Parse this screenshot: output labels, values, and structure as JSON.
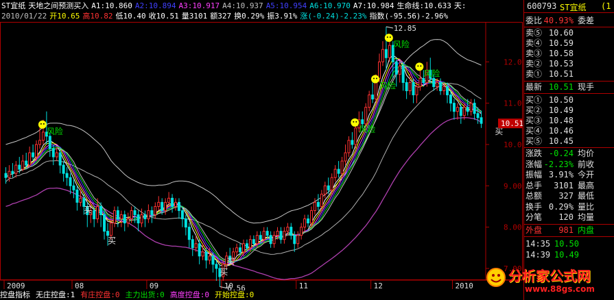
{
  "header": {
    "row1": [
      {
        "text": "ST宜纸",
        "color": "#ffffff"
      },
      {
        "text": "天地之间预测买入",
        "color": "#ffffff"
      },
      {
        "text": "A1:10.860",
        "color": "#ffffff"
      },
      {
        "text": "A2:10.894",
        "color": "#4040ff"
      },
      {
        "text": "A3:10.917",
        "color": "#ff40ff"
      },
      {
        "text": "A4:10.937",
        "color": "#c0c0c0"
      },
      {
        "text": "A5:10.954",
        "color": "#4040ff"
      },
      {
        "text": "A6:10.970",
        "color": "#00e0e0"
      },
      {
        "text": "A7:10.984",
        "color": "#ffffff"
      },
      {
        "text": "生命线:10.633",
        "color": "#ffffff"
      },
      {
        "text": "天:",
        "color": "#ffffff"
      }
    ],
    "row2": [
      {
        "text": "2010/01/22",
        "color": "#c0c0c0"
      },
      {
        "text": "开10.65",
        "color": "#ffff00"
      },
      {
        "text": "高10.82",
        "color": "#ff3232"
      },
      {
        "text": "低10.40",
        "color": "#ffffff"
      },
      {
        "text": "收10.51",
        "color": "#ffffff"
      },
      {
        "text": "量3101",
        "color": "#ffffff"
      },
      {
        "text": "额327",
        "color": "#ffffff"
      },
      {
        "text": "换0.29%",
        "color": "#ffffff"
      },
      {
        "text": "振3.91%",
        "color": "#ffffff"
      },
      {
        "text": "涨(-0.24)-2.23%",
        "color": "#00e0e0"
      },
      {
        "text": "指数(-95.56)-2.96%",
        "color": "#ffffff"
      }
    ]
  },
  "chart_data": {
    "type": "candlestick",
    "y_ticks": [
      "12.00",
      "11.00",
      "10.00",
      "9.00",
      "8.00",
      "7.00"
    ],
    "y_values": [
      12.0,
      11.0,
      10.0,
      9.0,
      8.0,
      7.0
    ],
    "ylim": [
      6.75,
      12.95
    ],
    "x_labels": [
      "2009",
      "08",
      "09",
      "10",
      "11",
      "12",
      "2010"
    ],
    "x_label_index": [
      0,
      20,
      42,
      64,
      86,
      108,
      132
    ],
    "current_price_label": "10.51",
    "high_label": "12.85",
    "low_label": "6.56",
    "annotations": [
      {
        "text": "风险",
        "index": 12,
        "price": 10.25
      },
      {
        "text": "风险",
        "index": 104,
        "price": 10.3
      },
      {
        "text": "风险",
        "index": 110,
        "price": 11.35
      },
      {
        "text": "风险",
        "index": 114,
        "price": 12.35
      },
      {
        "text": "风险",
        "index": 123,
        "price": 11.65
      },
      {
        "text": "买",
        "index": 23,
        "price": 8.35
      },
      {
        "text": "买",
        "index": 30,
        "price": 7.6
      },
      {
        "text": "买",
        "index": 65,
        "price": 7.1
      },
      {
        "text": "买",
        "index": 63,
        "price": 6.85
      },
      {
        "text": "买",
        "index": 144,
        "price": 10.25
      }
    ],
    "candles": [
      [
        9.3,
        9.2,
        9.45,
        9.05
      ],
      [
        9.2,
        9.35,
        9.5,
        9.1
      ],
      [
        9.35,
        9.3,
        9.55,
        9.2
      ],
      [
        9.3,
        9.5,
        9.6,
        9.2
      ],
      [
        9.5,
        9.4,
        9.7,
        9.3
      ],
      [
        9.4,
        9.6,
        9.75,
        9.35
      ],
      [
        9.6,
        9.5,
        9.8,
        9.4
      ],
      [
        9.5,
        9.8,
        9.95,
        9.45
      ],
      [
        9.8,
        9.7,
        10.0,
        9.6
      ],
      [
        9.7,
        10.0,
        10.1,
        9.6
      ],
      [
        10.0,
        10.1,
        10.4,
        9.9
      ],
      [
        10.1,
        10.3,
        10.6,
        10.0
      ],
      [
        10.3,
        10.2,
        10.8,
        10.0
      ],
      [
        10.2,
        9.9,
        10.3,
        9.7
      ],
      [
        9.9,
        9.7,
        10.0,
        9.5
      ],
      [
        9.7,
        9.8,
        9.95,
        9.6
      ],
      [
        9.8,
        9.5,
        9.9,
        9.3
      ],
      [
        9.5,
        9.3,
        9.6,
        9.1
      ],
      [
        9.3,
        9.2,
        9.45,
        9.0
      ],
      [
        9.2,
        9.0,
        9.3,
        8.8
      ],
      [
        9.0,
        8.9,
        9.15,
        8.7
      ],
      [
        8.9,
        8.6,
        9.0,
        8.4
      ],
      [
        8.6,
        8.7,
        8.9,
        8.5
      ],
      [
        8.7,
        8.5,
        8.8,
        8.3
      ],
      [
        8.5,
        8.3,
        8.6,
        8.0
      ],
      [
        8.3,
        8.4,
        8.6,
        8.1
      ],
      [
        8.4,
        8.2,
        8.5,
        8.0
      ],
      [
        8.2,
        8.5,
        8.7,
        8.1
      ],
      [
        8.5,
        8.3,
        8.6,
        8.0
      ],
      [
        8.3,
        7.9,
        8.4,
        7.7
      ],
      [
        7.9,
        7.8,
        8.1,
        7.55
      ],
      [
        7.8,
        8.1,
        8.3,
        7.7
      ],
      [
        8.1,
        8.4,
        8.5,
        8.0
      ],
      [
        8.4,
        8.2,
        8.5,
        8.0
      ],
      [
        8.2,
        8.3,
        8.4,
        8.0
      ],
      [
        8.3,
        8.1,
        8.4,
        7.9
      ],
      [
        8.1,
        8.2,
        8.35,
        8.0
      ],
      [
        8.2,
        8.4,
        8.5,
        8.1
      ],
      [
        8.4,
        8.3,
        8.5,
        8.1
      ],
      [
        8.3,
        8.1,
        8.4,
        7.9
      ],
      [
        8.1,
        8.3,
        8.45,
        8.0
      ],
      [
        8.3,
        8.2,
        8.4,
        8.0
      ],
      [
        8.2,
        8.4,
        8.55,
        8.1
      ],
      [
        8.4,
        8.3,
        8.5,
        8.1
      ],
      [
        8.3,
        8.5,
        8.6,
        8.2
      ],
      [
        8.5,
        8.6,
        8.75,
        8.4
      ],
      [
        8.6,
        8.4,
        8.7,
        8.3
      ],
      [
        8.4,
        8.6,
        8.7,
        8.3
      ],
      [
        8.6,
        8.7,
        8.85,
        8.5
      ],
      [
        8.7,
        8.5,
        8.8,
        8.35
      ],
      [
        8.5,
        8.6,
        8.7,
        8.4
      ],
      [
        8.6,
        8.4,
        8.7,
        8.2
      ],
      [
        8.4,
        8.2,
        8.5,
        8.0
      ],
      [
        8.2,
        8.0,
        8.3,
        7.8
      ],
      [
        8.0,
        7.7,
        8.1,
        7.5
      ],
      [
        7.7,
        7.5,
        7.8,
        7.3
      ],
      [
        7.5,
        7.6,
        7.8,
        7.4
      ],
      [
        7.6,
        7.3,
        7.7,
        7.1
      ],
      [
        7.3,
        7.4,
        7.6,
        7.2
      ],
      [
        7.4,
        7.2,
        7.5,
        7.0
      ],
      [
        7.2,
        7.3,
        7.5,
        7.1
      ],
      [
        7.3,
        7.1,
        7.4,
        6.9
      ],
      [
        7.1,
        7.0,
        7.2,
        6.7
      ],
      [
        7.0,
        6.8,
        7.1,
        6.56
      ],
      [
        6.8,
        7.1,
        7.2,
        6.7
      ],
      [
        7.1,
        7.3,
        7.4,
        7.0
      ],
      [
        7.3,
        7.2,
        7.5,
        7.1
      ],
      [
        7.2,
        7.4,
        7.5,
        7.1
      ],
      [
        7.4,
        7.5,
        7.6,
        7.3
      ],
      [
        7.5,
        7.4,
        7.6,
        7.3
      ],
      [
        7.4,
        7.6,
        7.7,
        7.3
      ],
      [
        7.6,
        7.5,
        7.7,
        7.4
      ],
      [
        7.5,
        7.7,
        7.8,
        7.4
      ],
      [
        7.7,
        7.6,
        7.8,
        7.5
      ],
      [
        7.6,
        7.8,
        7.9,
        7.5
      ],
      [
        7.8,
        7.7,
        7.9,
        7.6
      ],
      [
        7.7,
        7.9,
        8.0,
        7.6
      ],
      [
        7.9,
        7.8,
        8.0,
        7.7
      ],
      [
        7.8,
        7.6,
        7.9,
        7.5
      ],
      [
        7.6,
        7.8,
        7.9,
        7.5
      ],
      [
        7.8,
        7.9,
        8.0,
        7.7
      ],
      [
        7.9,
        7.7,
        8.0,
        7.6
      ],
      [
        7.7,
        7.9,
        8.0,
        7.6
      ],
      [
        7.9,
        8.0,
        8.1,
        7.8
      ],
      [
        8.0,
        7.8,
        8.1,
        7.7
      ],
      [
        7.8,
        7.6,
        7.9,
        7.4
      ],
      [
        7.6,
        7.8,
        7.9,
        7.5
      ],
      [
        7.8,
        8.0,
        8.1,
        7.7
      ],
      [
        8.0,
        8.2,
        8.3,
        7.9
      ],
      [
        8.2,
        8.1,
        8.3,
        8.0
      ],
      [
        8.1,
        8.4,
        8.5,
        8.0
      ],
      [
        8.4,
        8.6,
        8.7,
        8.3
      ],
      [
        8.6,
        8.5,
        8.8,
        8.4
      ],
      [
        8.5,
        8.8,
        8.9,
        8.4
      ],
      [
        8.8,
        9.0,
        9.1,
        8.7
      ],
      [
        9.0,
        8.9,
        9.2,
        8.8
      ],
      [
        8.9,
        9.2,
        9.3,
        8.8
      ],
      [
        9.2,
        9.4,
        9.5,
        9.1
      ],
      [
        9.4,
        9.3,
        9.6,
        9.2
      ],
      [
        9.3,
        9.6,
        9.7,
        9.2
      ],
      [
        9.6,
        9.8,
        10.0,
        9.5
      ],
      [
        9.8,
        10.1,
        10.2,
        9.7
      ],
      [
        10.1,
        10.0,
        10.3,
        9.9
      ],
      [
        10.0,
        10.4,
        10.5,
        9.9
      ],
      [
        10.4,
        10.6,
        10.8,
        10.3
      ],
      [
        10.6,
        10.5,
        10.8,
        10.4
      ],
      [
        10.5,
        10.9,
        11.0,
        10.4
      ],
      [
        10.9,
        11.2,
        11.3,
        10.8
      ],
      [
        11.2,
        11.1,
        11.5,
        11.0
      ],
      [
        11.1,
        11.6,
        11.7,
        11.0
      ],
      [
        11.6,
        12.0,
        12.2,
        11.5
      ],
      [
        12.0,
        12.3,
        12.5,
        11.9
      ],
      [
        12.3,
        12.1,
        12.85,
        11.8
      ],
      [
        12.1,
        12.4,
        12.6,
        12.0
      ],
      [
        12.4,
        12.0,
        12.5,
        11.6
      ],
      [
        12.0,
        11.7,
        12.1,
        11.4
      ],
      [
        11.7,
        11.9,
        12.0,
        11.5
      ],
      [
        11.9,
        11.5,
        12.0,
        11.3
      ],
      [
        11.5,
        11.3,
        11.6,
        11.1
      ],
      [
        11.3,
        11.5,
        11.7,
        11.2
      ],
      [
        11.5,
        11.2,
        11.6,
        11.0
      ],
      [
        11.2,
        11.4,
        11.5,
        11.0
      ],
      [
        11.4,
        11.6,
        11.8,
        11.3
      ],
      [
        11.6,
        11.5,
        11.8,
        11.4
      ],
      [
        11.5,
        11.8,
        12.0,
        11.4
      ],
      [
        11.8,
        11.6,
        12.1,
        11.5
      ],
      [
        11.6,
        11.4,
        11.7,
        11.3
      ],
      [
        11.4,
        11.5,
        11.6,
        11.3
      ],
      [
        11.5,
        11.3,
        11.6,
        11.2
      ],
      [
        11.3,
        11.4,
        11.5,
        11.2
      ],
      [
        11.4,
        11.2,
        11.5,
        11.0
      ],
      [
        11.2,
        11.0,
        11.3,
        10.8
      ],
      [
        11.0,
        10.8,
        11.1,
        10.6
      ],
      [
        10.8,
        10.9,
        11.0,
        10.6
      ],
      [
        10.9,
        10.7,
        11.0,
        10.5
      ],
      [
        10.7,
        10.9,
        11.0,
        10.6
      ],
      [
        10.9,
        10.8,
        11.1,
        10.7
      ],
      [
        10.8,
        11.0,
        11.1,
        10.7
      ],
      [
        11.0,
        10.75,
        11.1,
        10.6
      ],
      [
        10.75,
        10.65,
        10.9,
        10.5
      ],
      [
        10.65,
        10.51,
        10.82,
        10.4
      ]
    ]
  },
  "right_panel": {
    "code": "600793",
    "name": "ST宜纸",
    "tail": "(1",
    "weibi_label": "委比",
    "weibi_value": "40.93%",
    "weicha_label": "委差",
    "asks": [
      {
        "label": "卖⑤",
        "price": "10.60"
      },
      {
        "label": "卖④",
        "price": "10.59"
      },
      {
        "label": "卖③",
        "price": "10.58"
      },
      {
        "label": "卖②",
        "price": "10.53"
      },
      {
        "label": "卖①",
        "price": "10.51"
      }
    ],
    "latest_label": "最新",
    "latest_value": "10.51",
    "xianshou_label": "现手",
    "bids": [
      {
        "label": "买①",
        "price": "10.50"
      },
      {
        "label": "买②",
        "price": "10.49"
      },
      {
        "label": "买③",
        "price": "10.48"
      },
      {
        "label": "买④",
        "price": "10.46"
      },
      {
        "label": "买⑤",
        "price": "10.45"
      }
    ],
    "stats": [
      {
        "l1": "涨跌",
        "v1": "-0.24",
        "v1c": "#00e000",
        "l2": "均价"
      },
      {
        "l1": "涨幅",
        "v1": "-2.23%",
        "v1c": "#00e000",
        "l2": "前收"
      },
      {
        "l1": "振幅",
        "v1": "3.91%",
        "v1c": "#e0e0e0",
        "l2": "今开"
      },
      {
        "l1": "总手",
        "v1": "3101",
        "v1c": "#e0e0e0",
        "l2": "最高"
      },
      {
        "l1": "总额",
        "v1": "327",
        "v1c": "#e0e0e0",
        "l2": "最低"
      },
      {
        "l1": "换手",
        "v1": "0.29%",
        "v1c": "#e0e0e0",
        "l2": "量比"
      },
      {
        "l1": "分笔",
        "v1": "120",
        "v1c": "#e0e0e0",
        "l2": "均量"
      }
    ],
    "waipan_label": "外盘",
    "waipan_value": "981",
    "neipan_label": "内盘",
    "ticks": [
      {
        "time": "14:35",
        "price": "10.50"
      },
      {
        "time": "14:39",
        "price": "10.49"
      }
    ]
  },
  "bottom_bar": [
    {
      "text": "控盘指标",
      "color": "#ffffff"
    },
    {
      "text": "无庄控盘:1",
      "color": "#ffffff"
    },
    {
      "text": "有庄控盘:0",
      "color": "#ff3232"
    },
    {
      "text": "主力出货:0",
      "color": "#00e000"
    },
    {
      "text": "高度控盘:0",
      "color": "#ff40ff"
    },
    {
      "text": "开始控盘:0",
      "color": "#ffff00"
    }
  ],
  "watermark": {
    "title": "分析家公式网",
    "url": "www.88gs.com"
  },
  "colors": {
    "up": "#ff3232",
    "down": "#00e0e0",
    "border": "#b00000",
    "upper_band": "#c8c8c8",
    "lower_band": "#b040b0"
  }
}
